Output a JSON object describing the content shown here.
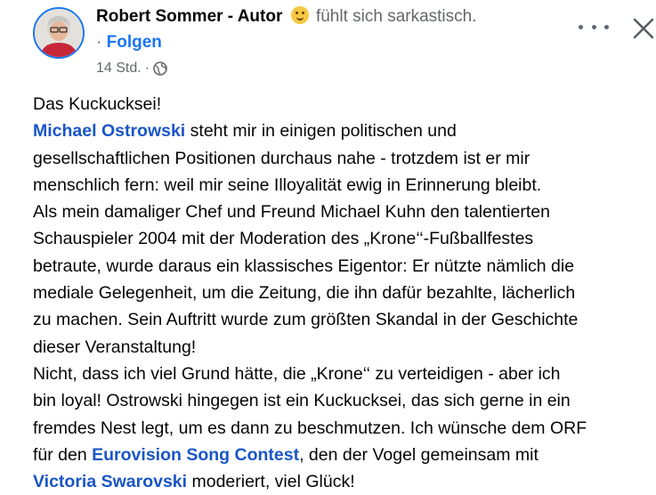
{
  "post": {
    "author": "Robert Sommer - Autor",
    "feeling": "fühlt sich sarkastisch.",
    "separator": "·",
    "follow_label": "Folgen",
    "timestamp": "14 Std.",
    "timestamp_separator": "·",
    "privacy_icon": "globe-icon",
    "emoji_icon": "smirk-emoji-icon"
  },
  "body": {
    "l1": "Das Kuckucksei!",
    "l2_mention": "Michael Ostrowski",
    "l2_rest": " steht mir in einigen politischen und",
    "l3": "gesellschaftlichen Positionen durchaus nahe - trotzdem ist er mir",
    "l4": "menschlich fern: weil mir seine Illoyalität ewig in Erinnerung bleibt.",
    "l5": "Als mein damaliger Chef und Freund Michael Kuhn den talentierten",
    "l6": "Schauspieler 2004 mit der Moderation des „Krone‘‘-Fußballfestes",
    "l7": "betraute, wurde daraus ein klassisches Eigentor: Er nützte nämlich die",
    "l8": "mediale Gelegenheit, um die Zeitung, die ihn dafür bezahlte, lächerlich",
    "l9": "zu machen. Sein Auftritt wurde zum größten Skandal in der Geschichte",
    "l10": "dieser Veranstaltung!",
    "l11": "Nicht, dass ich viel Grund hätte, die „Krone‘‘ zu verteidigen - aber ich",
    "l12": "bin loyal! Ostrowski hingegen ist ein Kuckucksei, das sich gerne in ein",
    "l13": "fremdes Nest legt, um es dann zu beschmutzen. Ich wünsche dem ORF",
    "l14_pre": "für den ",
    "l14_mention": "Eurovision Song Contest",
    "l14_rest": ", den der Vogel gemeinsam mit",
    "l15_mention": "Victoria Swarovski",
    "l15_rest": " moderiert, viel Glück!"
  },
  "colors": {
    "link": "#1a56c6",
    "follow": "#1877f2",
    "secondary_text": "#65676b"
  },
  "icons": {
    "more": "more-options-icon",
    "close": "close-icon"
  }
}
